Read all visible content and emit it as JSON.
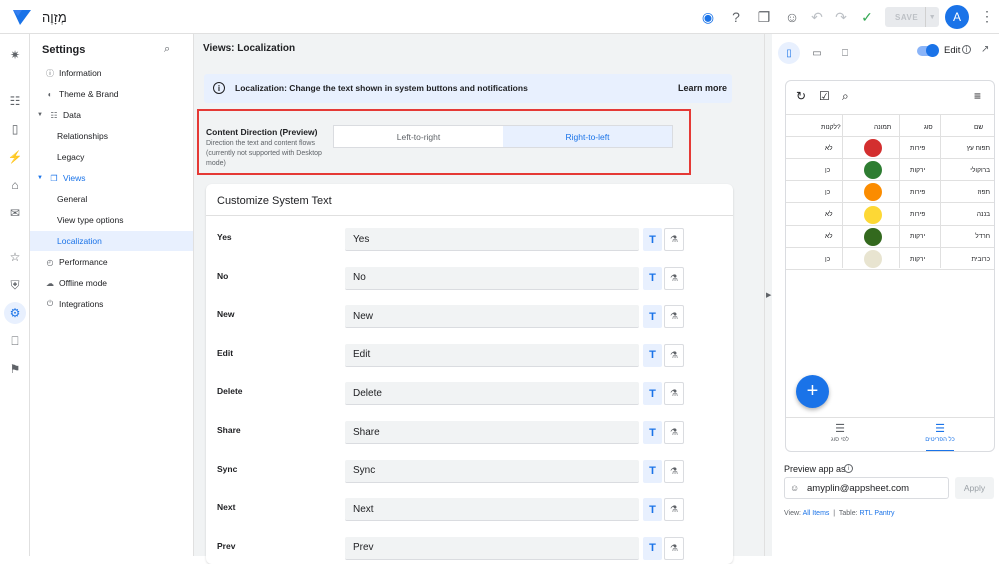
{
  "app": {
    "name": "מְזָוֶה",
    "avatar_letter": "A",
    "save_label": "SAVE"
  },
  "sidebar": {
    "title": "Settings",
    "items": [
      {
        "label": "Information",
        "icon": "info-icon"
      },
      {
        "label": "Theme & Brand",
        "icon": "palette-icon"
      },
      {
        "label": "Data",
        "icon": "table-icon"
      },
      {
        "label": "Relationships"
      },
      {
        "label": "Legacy"
      },
      {
        "label": "Views",
        "icon": "views-icon"
      },
      {
        "label": "General"
      },
      {
        "label": "View type options"
      },
      {
        "label": "Localization",
        "selected": true
      },
      {
        "label": "Performance",
        "icon": "speed-icon"
      },
      {
        "label": "Offline mode",
        "icon": "offline-icon"
      },
      {
        "label": "Integrations",
        "icon": "plug-icon"
      }
    ]
  },
  "main": {
    "title": "Views: Localization",
    "banner_text": "Localization: Change the text shown in system buttons and notifications",
    "learn_more": "Learn more",
    "direction": {
      "label": "Content Direction (Preview)",
      "description": "Direction the text and content flows (currently not supported with Desktop mode)",
      "options": [
        "Left-to-right",
        "Right-to-left"
      ],
      "selected": "Right-to-left"
    },
    "card_title": "Customize System Text",
    "rows": [
      {
        "label": "Yes",
        "value": "Yes"
      },
      {
        "label": "No",
        "value": "No"
      },
      {
        "label": "New",
        "value": "New"
      },
      {
        "label": "Edit",
        "value": "Edit"
      },
      {
        "label": "Delete",
        "value": "Delete"
      },
      {
        "label": "Share",
        "value": "Share"
      },
      {
        "label": "Sync",
        "value": "Sync"
      },
      {
        "label": "Next",
        "value": "Next"
      },
      {
        "label": "Prev",
        "value": "Prev"
      }
    ]
  },
  "preview": {
    "edit_label": "Edit",
    "table_headers": [
      "שם",
      "סוג",
      "תמונה",
      "לקנות?"
    ],
    "table_rows": [
      {
        "name": "תפוח עץ",
        "type": "פירות",
        "buy": "לא",
        "color": "#d32f2f"
      },
      {
        "name": "ברוקולי",
        "type": "ירקות",
        "buy": "כן",
        "color": "#2e7d32"
      },
      {
        "name": "תפוז",
        "type": "פירות",
        "buy": "כן",
        "color": "#fb8c00"
      },
      {
        "name": "בננה",
        "type": "פירות",
        "buy": "לא",
        "color": "#fdd835"
      },
      {
        "name": "חרדל",
        "type": "ירקות",
        "buy": "לא",
        "color": "#33691e"
      },
      {
        "name": "כרובית",
        "type": "ירקות",
        "buy": "כן",
        "color": "#e8e4d0"
      }
    ],
    "bottom_nav": [
      {
        "label": "לפי סוג"
      },
      {
        "label": "כל הפריטים",
        "selected": true
      }
    ],
    "preview_as_label": "Preview app as",
    "email": "amyplin@appsheet.com",
    "apply_label": "Apply",
    "view_prefix": "View:",
    "view_name": "All Items",
    "table_prefix": "Table:",
    "table_name": "RTL Pantry"
  }
}
